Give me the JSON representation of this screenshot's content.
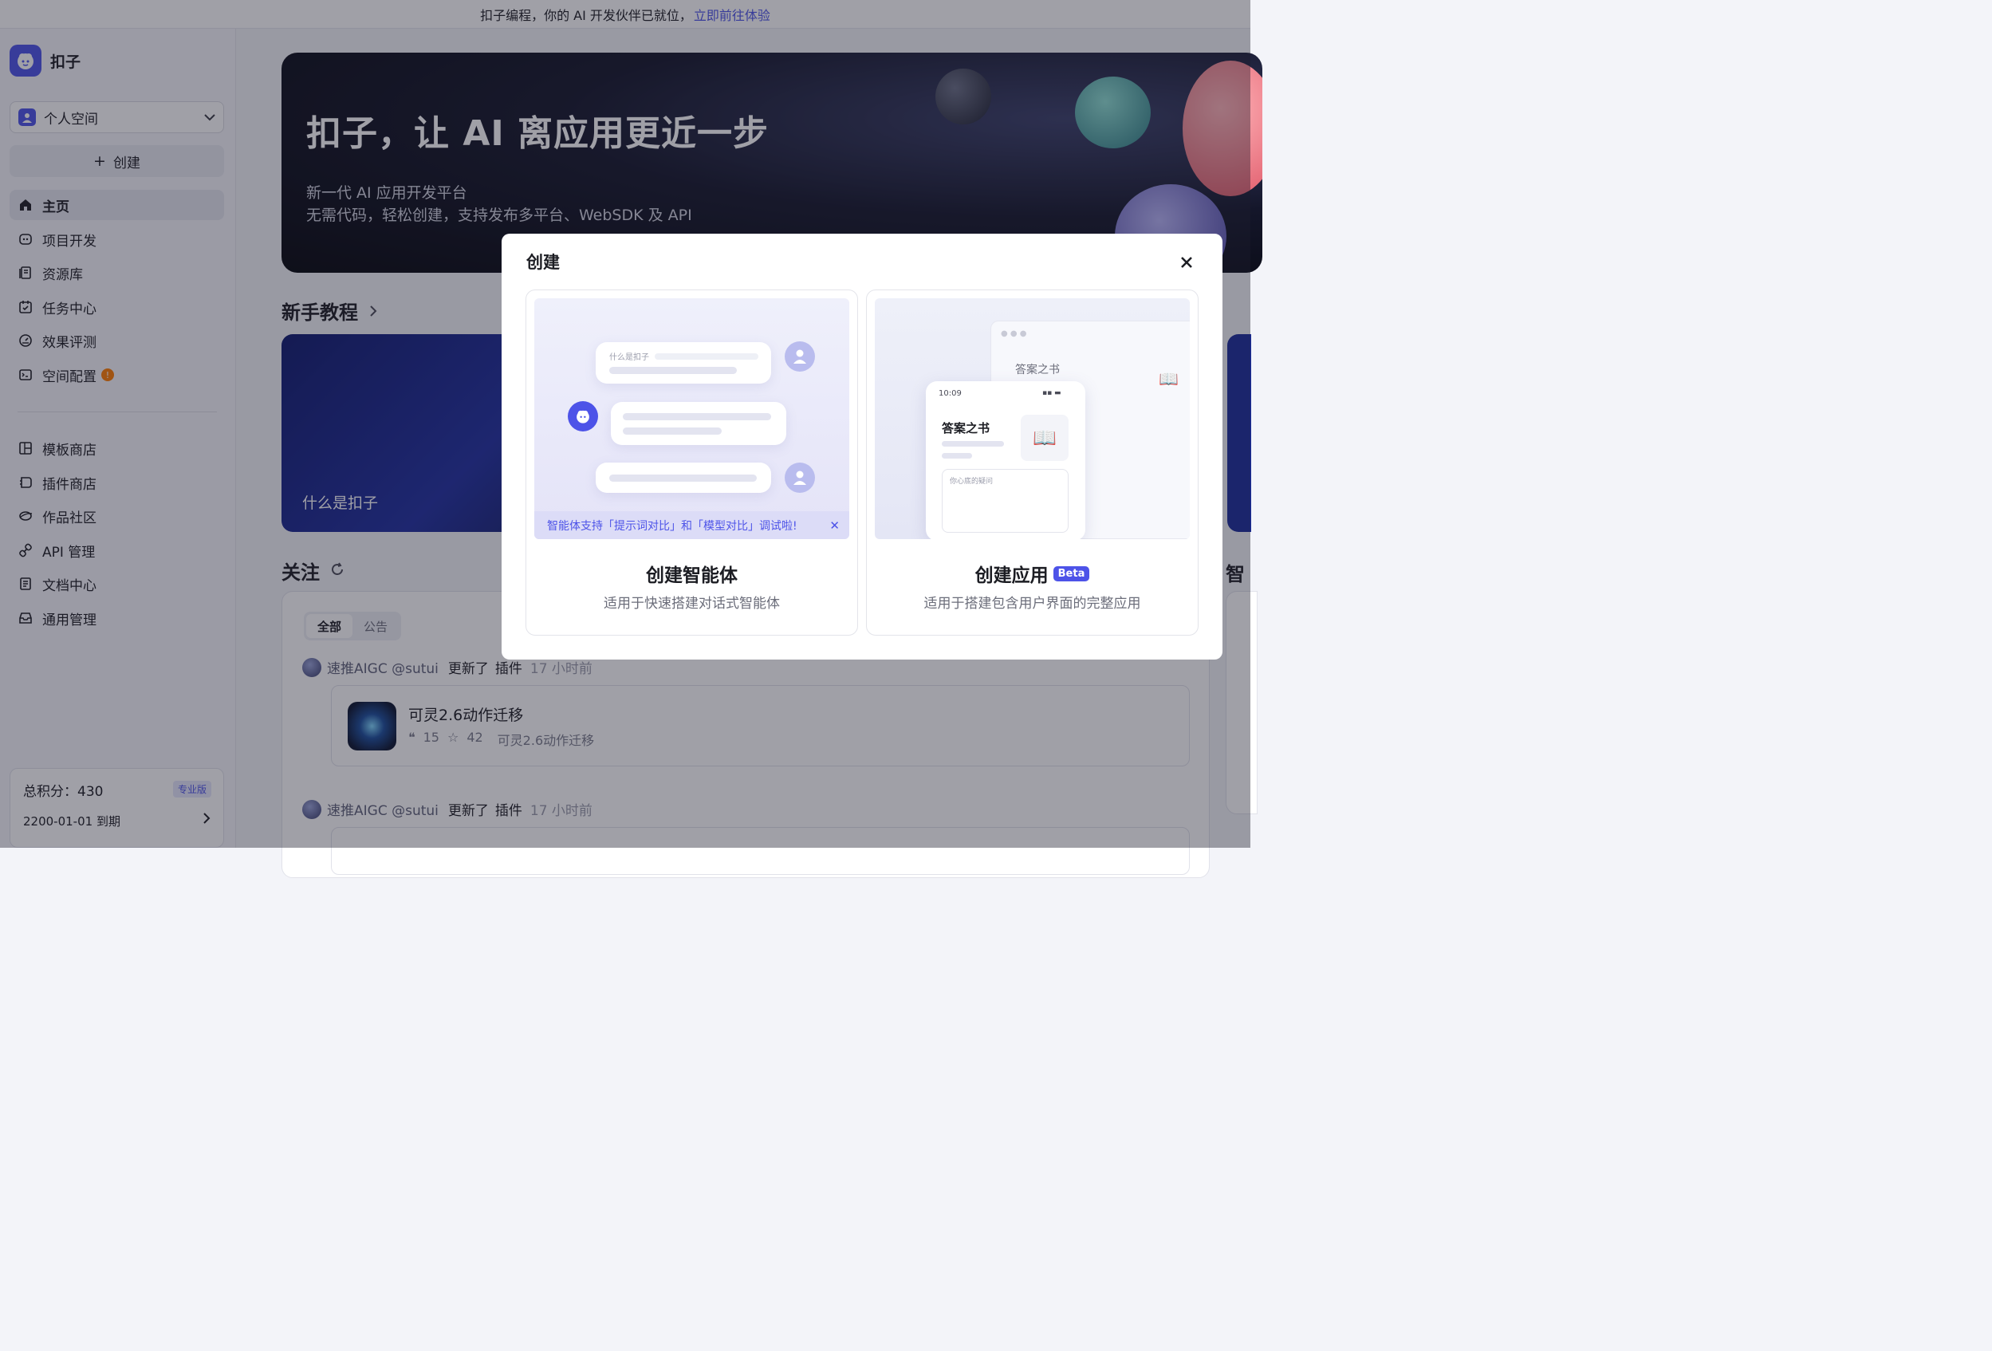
{
  "top_notice": {
    "text": "扣子编程，你的 AI 开发伙伴已就位，",
    "link": "立即前往体验"
  },
  "sidebar": {
    "app_name": "扣子",
    "space": "个人空间",
    "create_label": "创建",
    "nav": [
      {
        "label": "主页",
        "icon": "home-icon"
      },
      {
        "label": "项目开发",
        "icon": "project-icon"
      },
      {
        "label": "资源库",
        "icon": "library-icon"
      },
      {
        "label": "任务中心",
        "icon": "task-icon"
      },
      {
        "label": "效果评测",
        "icon": "gauge-icon"
      },
      {
        "label": "空间配置",
        "icon": "terminal-icon",
        "badge": "!"
      }
    ],
    "nav2": [
      {
        "label": "模板商店",
        "icon": "template-icon"
      },
      {
        "label": "插件商店",
        "icon": "plugin-icon"
      },
      {
        "label": "作品社区",
        "icon": "community-icon"
      },
      {
        "label": "API 管理",
        "icon": "link-icon"
      },
      {
        "label": "文档中心",
        "icon": "doc-icon"
      },
      {
        "label": "通用管理",
        "icon": "inbox-icon"
      }
    ],
    "points": {
      "label": "总积分：430",
      "tier": "专业版",
      "expire": "2200-01-01 到期"
    }
  },
  "hero": {
    "title": "扣子，让 AI 离应用更近一步",
    "sub1": "新一代 AI 应用开发平台",
    "sub2": "无需代码，轻松创建，支持发布多平台、WebSDK 及 API"
  },
  "tutorial": {
    "title": "新手教程",
    "card_title": "什么是扣子"
  },
  "follow": {
    "title": "关注",
    "tabs": [
      "全部",
      "公告"
    ],
    "right_title": "智",
    "feed": [
      {
        "user": "速推AIGC @sutui",
        "action": "更新了",
        "type": "插件",
        "time": "17 小时前",
        "plugin": {
          "name": "可灵2.6动作迁移",
          "quotes": "15",
          "stars": "42",
          "desc": "可灵2.6动作迁移"
        }
      },
      {
        "user": "速推AIGC @sutui",
        "action": "更新了",
        "type": "插件",
        "time": "17 小时前"
      }
    ]
  },
  "modal": {
    "title": "创建",
    "agent": {
      "title": "创建智能体",
      "desc": "适用于快速搭建对话式智能体",
      "preview_q": "什么是扣子",
      "banner": "智能体支持「提示词对比」和「模型对比」调试啦!"
    },
    "app": {
      "title": "创建应用",
      "beta": "Beta",
      "desc": "适用于搭建包含用户界面的完整应用",
      "preview_title": "答案之书",
      "preview_time": "10:09",
      "preview_placeholder": "你心底的疑问",
      "book_glyph": "📖"
    }
  },
  "colors": {
    "accent": "#4d53e8",
    "badge": "#ff7d00"
  }
}
